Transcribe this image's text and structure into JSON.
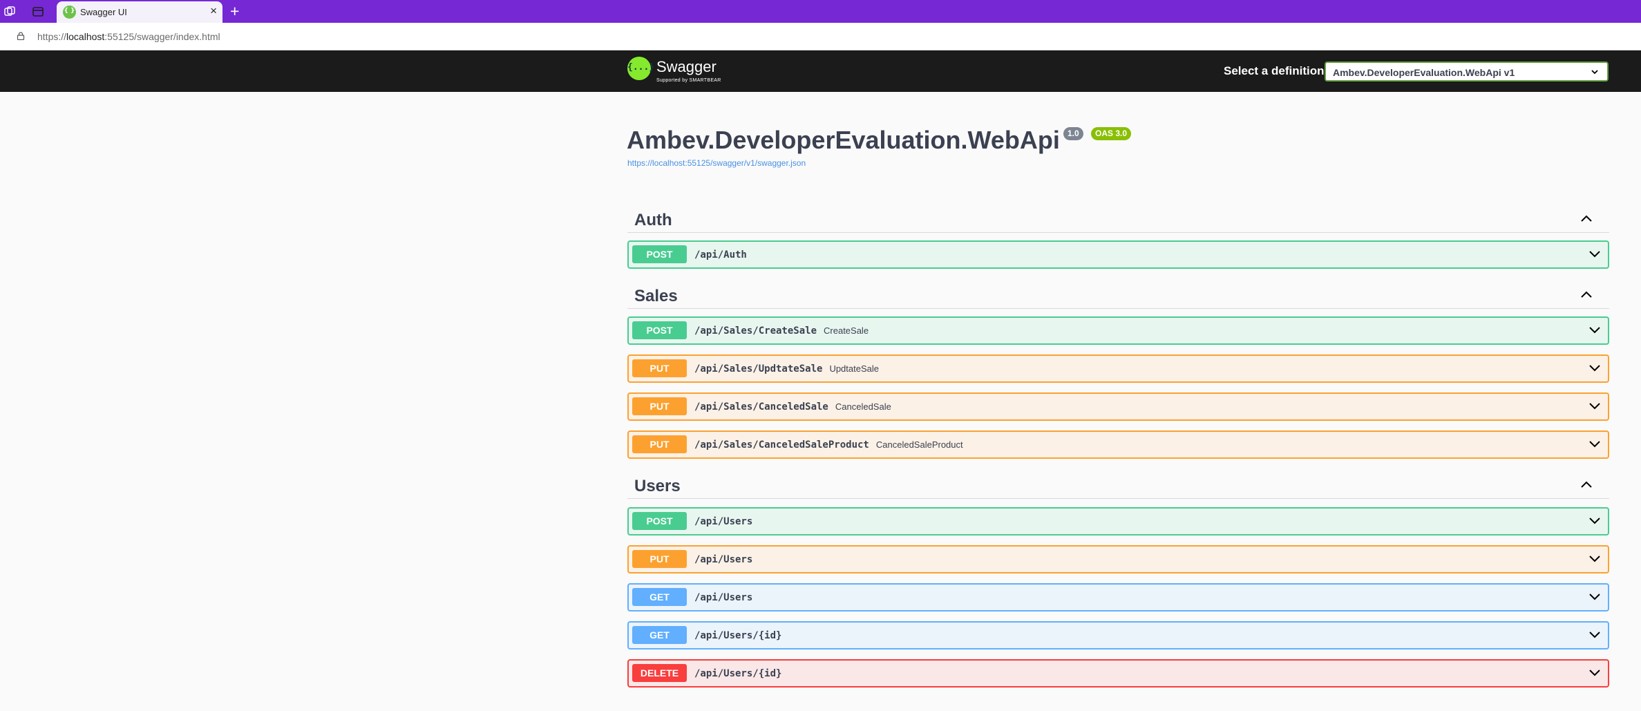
{
  "browser": {
    "tab_title": "Swagger UI",
    "tab_close": "×",
    "new_tab": "+",
    "url_prefix": "https://",
    "url_host": "localhost",
    "url_rest": ":55125/swagger/index.html"
  },
  "topbar": {
    "logo_mark": "{...}",
    "logo_name": "Swagger",
    "logo_sub": "Supported by SMARTBEAR",
    "definition_label": "Select a definition",
    "definition_selected": "Ambev.DeveloperEvaluation.WebApi v1"
  },
  "info": {
    "title": "Ambev.DeveloperEvaluation.WebApi",
    "version": "1.0",
    "oas": "OAS 3.0",
    "spec_url": "https://localhost:55125/swagger/v1/swagger.json"
  },
  "tags": {
    "auth": "Auth",
    "sales": "Sales",
    "users": "Users"
  },
  "operations": {
    "auth_post": {
      "method": "POST",
      "path": "/api/Auth",
      "summary": ""
    },
    "sales_create": {
      "method": "POST",
      "path": "/api/Sales/CreateSale",
      "summary": "CreateSale"
    },
    "sales_update": {
      "method": "PUT",
      "path": "/api/Sales/UpdtateSale",
      "summary": "UpdtateSale"
    },
    "sales_cancel": {
      "method": "PUT",
      "path": "/api/Sales/CanceledSale",
      "summary": "CanceledSale"
    },
    "sales_cancel_product": {
      "method": "PUT",
      "path": "/api/Sales/CanceledSaleProduct",
      "summary": "CanceledSaleProduct"
    },
    "users_post": {
      "method": "POST",
      "path": "/api/Users",
      "summary": ""
    },
    "users_put": {
      "method": "PUT",
      "path": "/api/Users",
      "summary": ""
    },
    "users_get": {
      "method": "GET",
      "path": "/api/Users",
      "summary": ""
    },
    "users_get_id": {
      "method": "GET",
      "path": "/api/Users/{id}",
      "summary": ""
    },
    "users_delete_id": {
      "method": "DELETE",
      "path": "/api/Users/{id}",
      "summary": ""
    }
  },
  "colors": {
    "post": "#49cc90",
    "put": "#fca130",
    "get": "#61affe",
    "delete": "#f93e3e",
    "browser_accent": "#7628d4"
  }
}
